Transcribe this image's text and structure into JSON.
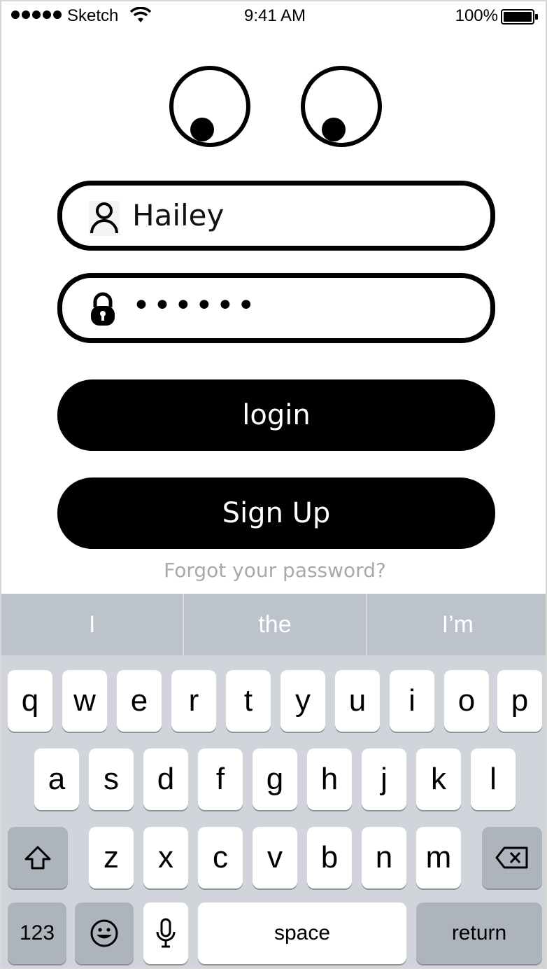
{
  "status_bar": {
    "carrier": "Sketch",
    "time": "9:41 AM",
    "battery": "100%"
  },
  "login_form": {
    "username_value": "Hailey",
    "password_mask": "••••••",
    "login_label": "login",
    "signup_label": "Sign Up",
    "forgot_label": "Forgot your password?"
  },
  "keyboard": {
    "suggestions": [
      "I",
      "the",
      "I’m"
    ],
    "row1": [
      "q",
      "w",
      "e",
      "r",
      "t",
      "y",
      "u",
      "i",
      "o",
      "p"
    ],
    "row2": [
      "a",
      "s",
      "d",
      "f",
      "g",
      "h",
      "j",
      "k",
      "l"
    ],
    "row3": [
      "z",
      "x",
      "c",
      "v",
      "b",
      "n",
      "m"
    ],
    "numbers_label": "123",
    "space_label": "space",
    "return_label": "return"
  },
  "icons": [
    "wifi-icon",
    "battery-icon",
    "user-icon",
    "lock-icon",
    "shift-icon",
    "backspace-icon",
    "emoji-icon",
    "microphone-icon"
  ]
}
